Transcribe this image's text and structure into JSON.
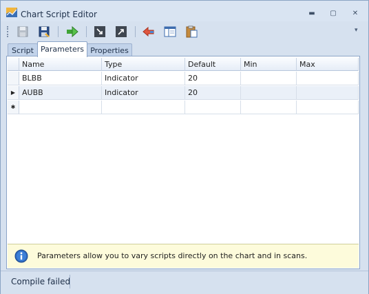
{
  "window": {
    "title": "Chart Script Editor"
  },
  "window_buttons": {
    "minimize": "▬",
    "restore": "▢",
    "close": "✕"
  },
  "toolbar": {
    "icons": [
      "save-icon",
      "save-as-icon",
      "compile-icon",
      "import-icon",
      "export-icon",
      "undo-icon",
      "layout-icon",
      "paste-icon"
    ],
    "overflow": "▾"
  },
  "tabs": [
    {
      "label": "Script"
    },
    {
      "label": "Parameters",
      "selected": true
    },
    {
      "label": "Properties"
    }
  ],
  "grid": {
    "columns": [
      "Name",
      "Type",
      "Default",
      "Min",
      "Max"
    ],
    "rows": [
      {
        "name": "BLBB",
        "type": "Indicator",
        "default": "20",
        "min": "",
        "max": ""
      },
      {
        "name": "AUBB",
        "type": "Indicator",
        "default": "20",
        "min": "",
        "max": "",
        "current": true
      }
    ],
    "current_row_marker": "▶",
    "new_row_marker": "✱"
  },
  "info": {
    "text": "Parameters allow you to vary scripts directly on the chart and in scans."
  },
  "status": {
    "text": "Compile failed"
  },
  "colors": {
    "accent": "#2b6fc1",
    "info_background": "#fdfbdb",
    "chrome": "#d6e1ef"
  }
}
